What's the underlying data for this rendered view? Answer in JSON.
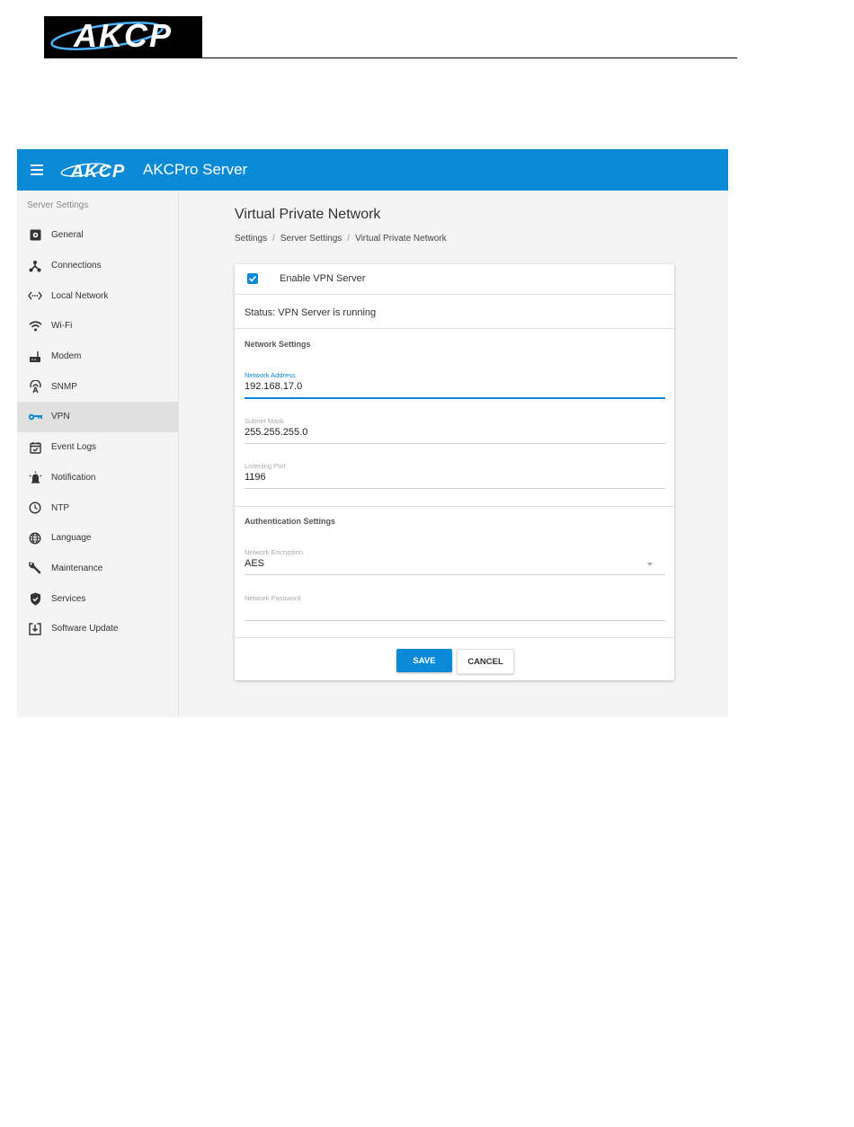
{
  "doc_header": {
    "logo_text": "AKCP"
  },
  "app": {
    "logo_text": "AKCP",
    "title": "AKCPro Server"
  },
  "sidebar": {
    "heading": "Server Settings",
    "items": [
      {
        "label": "General",
        "icon": "gear-icon",
        "active": false
      },
      {
        "label": "Connections",
        "icon": "connections-icon",
        "active": false
      },
      {
        "label": "Local Network",
        "icon": "local-network-icon",
        "active": false
      },
      {
        "label": "Wi-Fi",
        "icon": "wifi-icon",
        "active": false
      },
      {
        "label": "Modem",
        "icon": "modem-icon",
        "active": false
      },
      {
        "label": "SNMP",
        "icon": "snmp-icon",
        "active": false
      },
      {
        "label": "VPN",
        "icon": "key-icon",
        "active": true
      },
      {
        "label": "Event Logs",
        "icon": "calendar-check-icon",
        "active": false
      },
      {
        "label": "Notification",
        "icon": "alarm-icon",
        "active": false
      },
      {
        "label": "NTP",
        "icon": "clock-icon",
        "active": false
      },
      {
        "label": "Language",
        "icon": "globe-icon",
        "active": false
      },
      {
        "label": "Maintenance",
        "icon": "wrench-icon",
        "active": false
      },
      {
        "label": "Services",
        "icon": "shield-check-icon",
        "active": false
      },
      {
        "label": "Software Update",
        "icon": "download-box-icon",
        "active": false
      }
    ]
  },
  "main": {
    "title": "Virtual Private Network",
    "breadcrumb": [
      "Settings",
      "Server Settings",
      "Virtual Private Network"
    ],
    "enable_vpn": {
      "label": "Enable VPN Server",
      "checked": true
    },
    "status": "Status: VPN Server is running",
    "network_settings": {
      "title": "Network Settings",
      "network_address": {
        "label": "Network Address",
        "value": "192.168.17.0"
      },
      "subnet_mask": {
        "label": "Subnet Mask",
        "value": "255.255.255.0"
      },
      "listening_port": {
        "label": "Listening Port",
        "value": "1196"
      }
    },
    "authentication_settings": {
      "title": "Authentication Settings",
      "network_encryption": {
        "label": "Network Encryption",
        "value": "AES"
      },
      "network_password": {
        "label": "Network Password",
        "value": ""
      }
    },
    "buttons": {
      "save": "SAVE",
      "cancel": "CANCEL"
    }
  },
  "colors": {
    "accent": "#0a89d6",
    "sidebar_bg": "#f4f4f4",
    "active_item_bg": "#e0e0e0"
  }
}
